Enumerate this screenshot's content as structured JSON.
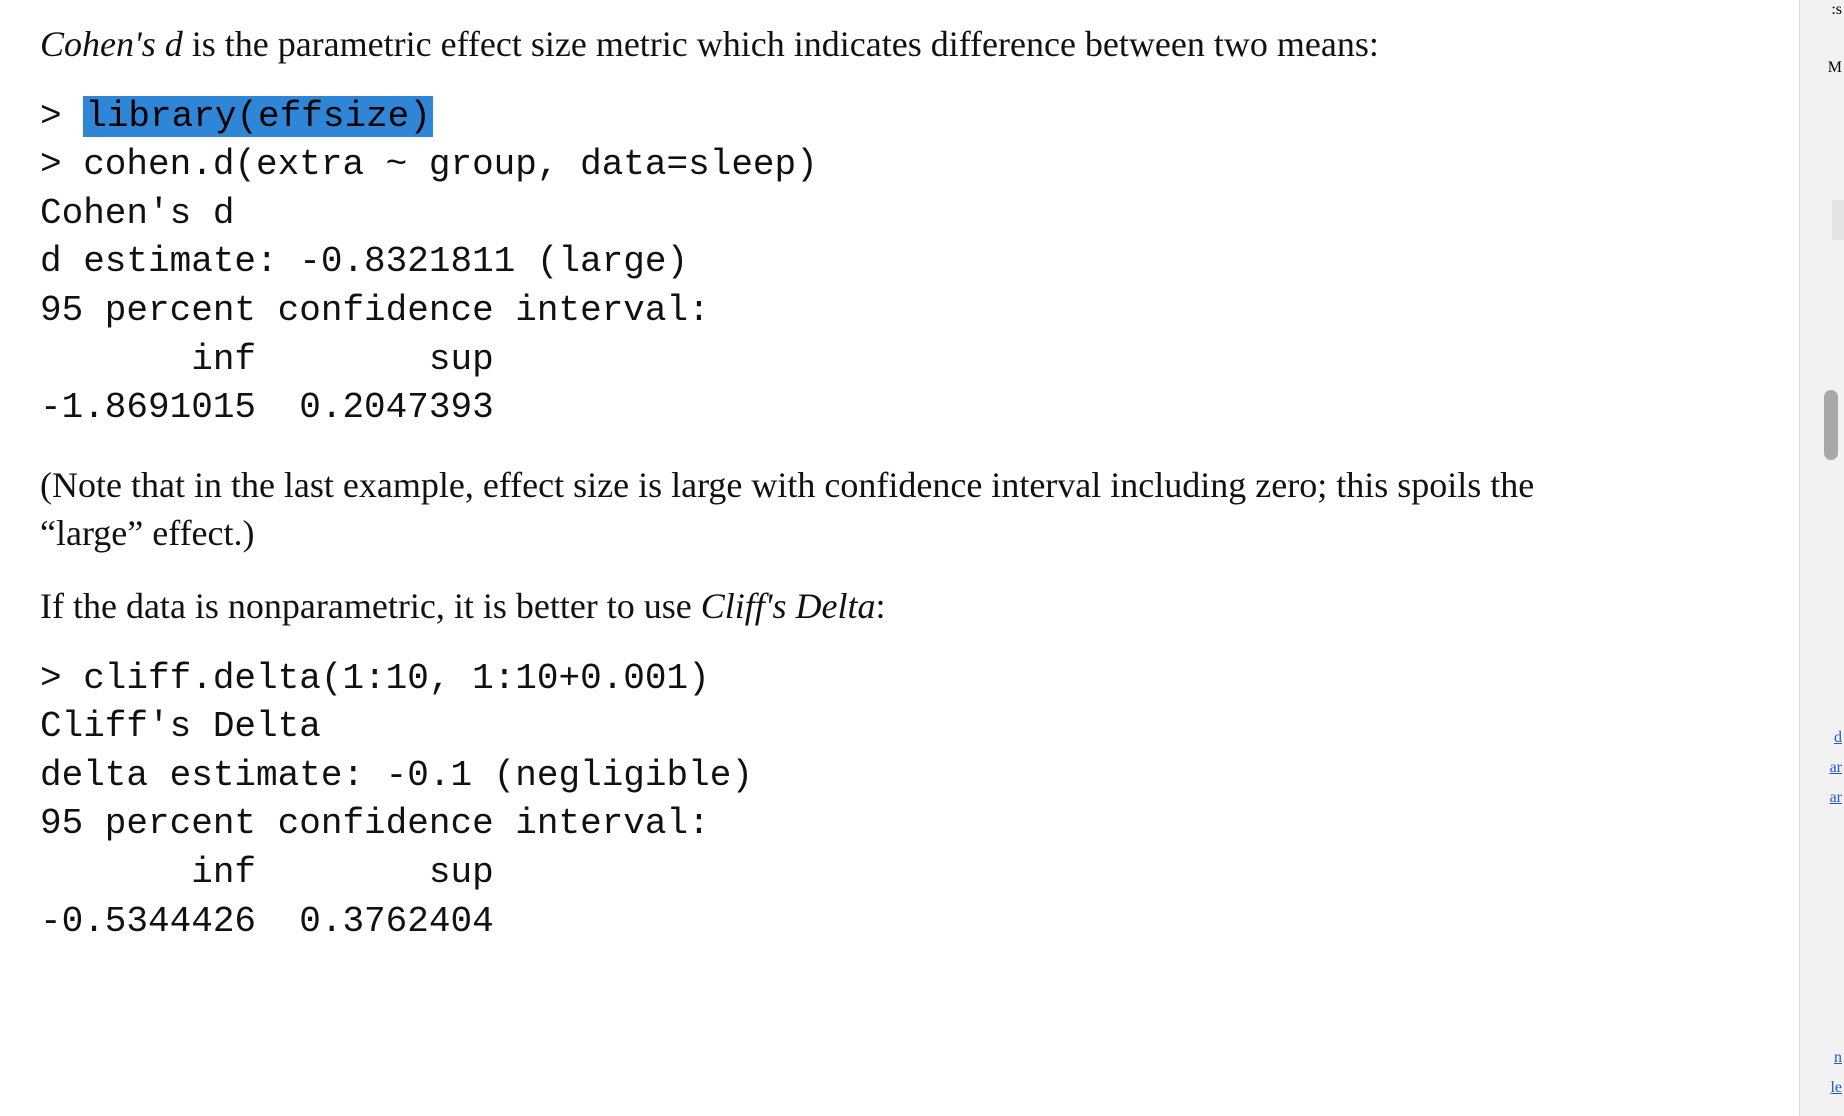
{
  "intro": {
    "em": "Cohen's d",
    "rest": " is the parametric effect size metric which indicates difference between two means:"
  },
  "code1": {
    "prompt1": "> ",
    "highlight": "library(effsize)",
    "line2": "> cohen.d(extra ~ group, data=sleep)",
    "line3": "Cohen's d",
    "line4": "d estimate: -0.8321811 (large)",
    "line5": "95 percent confidence interval:",
    "line6": "       inf        sup ",
    "line7": "-1.8691015  0.2047393"
  },
  "note": "(Note that in the last example, effect size is large with confidence interval including zero; this spoils the “large” effect.)",
  "para2": {
    "lead": "If the data is nonparametric, it is better to use ",
    "em": "Cliff's Delta",
    "tail": ":"
  },
  "code2": {
    "line1": "> cliff.delta(1:10, 1:10+0.001)",
    "line2": "Cliff's Delta",
    "line3": "delta estimate: -0.1 (negligible)",
    "line4": "95 percent confidence interval:",
    "line5": "       inf        sup ",
    "line6": "-0.5344426  0.3762404"
  },
  "gutter": {
    "f1": ":s",
    "f2": "M",
    "f3": "d",
    "f4": "ar",
    "f5": "ar",
    "f6": "n",
    "f7": "le"
  }
}
